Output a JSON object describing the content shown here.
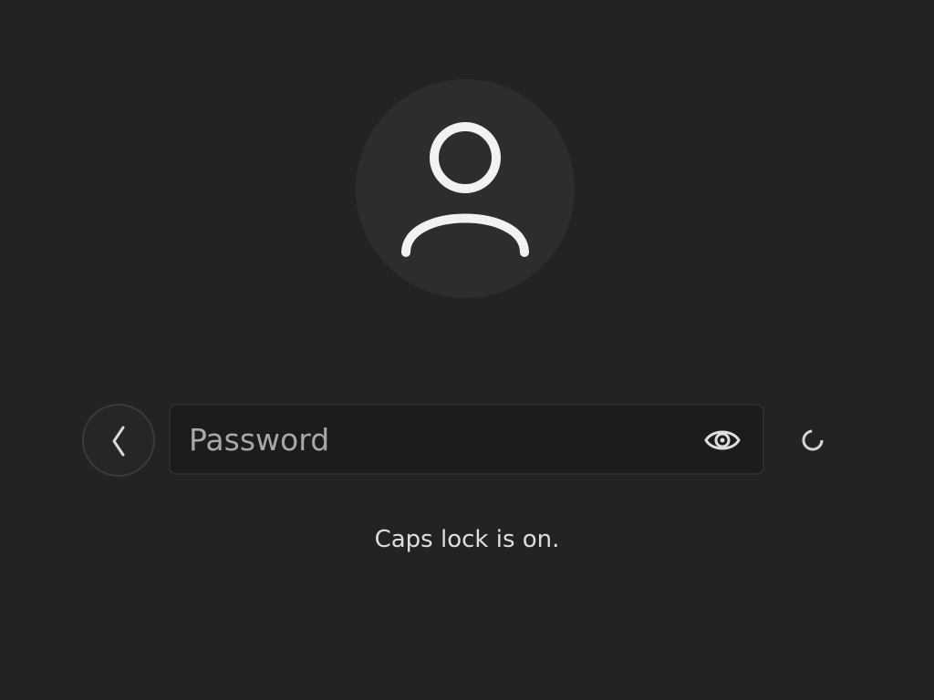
{
  "login": {
    "avatar_icon": "user-icon",
    "back_icon": "chevron-left-icon",
    "password_field": {
      "placeholder": "Password",
      "value": "",
      "reveal_icon": "eye-icon"
    },
    "spinner_icon": "loading-spinner-icon",
    "caps_lock_message": "Caps lock is on."
  },
  "colors": {
    "background": "#232323",
    "avatar_background": "#2d2d2d",
    "input_background": "#1c1c1c",
    "text": "#dedede",
    "placeholder": "#a8a8a8"
  }
}
